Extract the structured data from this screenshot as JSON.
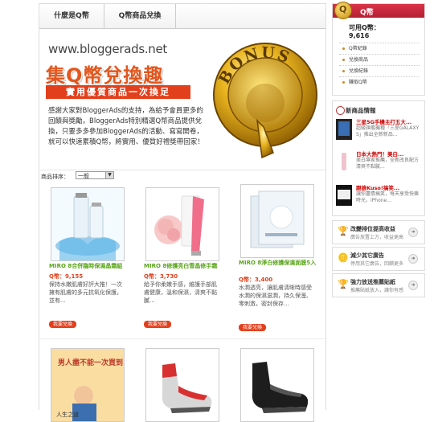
{
  "tabs": [
    "什麼是Q幣",
    "Q幣商品兌換"
  ],
  "banner": {
    "site_url": "www.bloggerads.net",
    "headline": "集Q幣兌換趣",
    "subline": "實用優質商品一次換足",
    "intro": "感謝大家對BloggerAds的支持，為給予會員更多的回饋與獎勵，BloggerAds特別精選Q幣商品提供兌換，只要多多參加BloggerAds的活動、寫寫開卷，就可以快速累積Q幣，將實用、優質好禮獎帶回家！",
    "coin_text": "BONUS",
    "coin_letter": "Q"
  },
  "sort": {
    "label": "商品排序：",
    "selected": "一般"
  },
  "products": [
    {
      "name": "MIRO 8合併臨時保濕晶霜組",
      "price": "Q幣：9,155",
      "desc": "保持水嫩肌膚好評大推！一次擁有肌膚的多元抗氧化保護，並有...",
      "button": "我要兌換"
    },
    {
      "name": "MIRO 8修護亮白雪晶修手霜",
      "price": "Q幣：3,730",
      "desc": "給予你柔嫩手感，維護手部肌膚健康，溫和保濕，清爽不黏膩...",
      "button": "我要兌換"
    },
    {
      "name": "MIRO 8淨白修護保濕面膜5入",
      "price": "Q幣：3,400",
      "desc": "水潤透亮，讓肌膚清晰時感受水潤的保濕滋潤，持久保溼、零刺激，密封保存...",
      "button": "我要兌換"
    }
  ],
  "products_row2": [
    {
      "book_title": "男人盡不能一次買到",
      "caption": "人生之道"
    },
    {
      "img": "red-sock"
    },
    {
      "img": "black-sock"
    }
  ],
  "sidebar": {
    "q_title": "Q幣",
    "q_available_label": "可用Q幣：",
    "q_available_value": "9,616",
    "links": [
      "Q幣紀錄",
      "兌換商品",
      "兌換紀錄",
      "賺取Q幣"
    ],
    "news_title": "新商品情報",
    "news": [
      {
        "head": "三星5G手機主打五大...",
        "text": "超級旗艦機種「三星GALAXY S」推出全新新品..."
      },
      {
        "head": "日本大熱門！美白...",
        "text": "美白專家推薦，全新改良配方清爽不黏膩..."
      },
      {
        "head": "跟誰Kuso!搞笑...",
        "text": "讓你盡情搞笑，每天享受快樂時光，iPhone..."
      }
    ],
    "actions": [
      {
        "title": "改變排位提高收益",
        "sub": "廣告放置上方，收益更高"
      },
      {
        "title": "減少其它廣告",
        "sub": "停用其它廣告，回饋更多"
      },
      {
        "title": "強力放送推薦貼紙",
        "sub": "推薦貼紙放入，讓你有感"
      }
    ]
  }
}
